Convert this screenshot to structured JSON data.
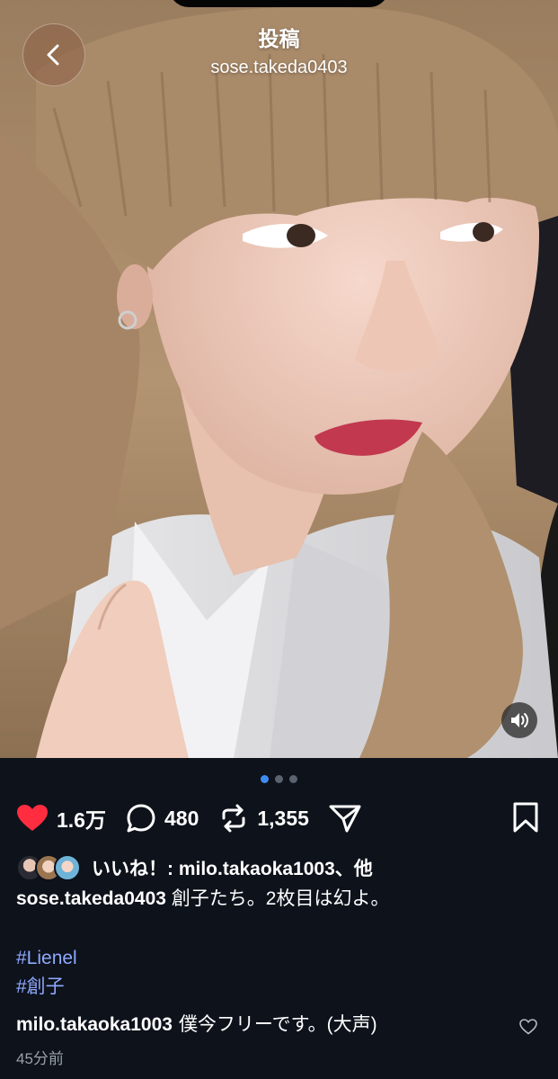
{
  "header": {
    "title": "投稿",
    "username": "sose.takeda0403",
    "back_icon": "chevron-left-icon"
  },
  "photo": {
    "description_icon": "post-photo",
    "sound_icon": "speaker-icon",
    "carousel_index": 1,
    "carousel_total": 3
  },
  "actions": {
    "likes": "1.6万",
    "comments": "480",
    "reposts": "1,355",
    "like_color": "#ff2d3f"
  },
  "likes_row": {
    "text": "いいね！: milo.takaoka1003、他"
  },
  "caption": {
    "username": "sose.takeda0403",
    "text": "創子たち。2枚目は幻よ。"
  },
  "hashtags": [
    "#Lienel",
    "#創子"
  ],
  "comment": {
    "username": "milo.takaoka1003",
    "text": "僕今フリーです。(大声)"
  },
  "timestamp": "45分前",
  "colors": {
    "background": "#0d121b",
    "hashtag": "#8fa9ff",
    "dot_active": "#3f8cf0"
  }
}
